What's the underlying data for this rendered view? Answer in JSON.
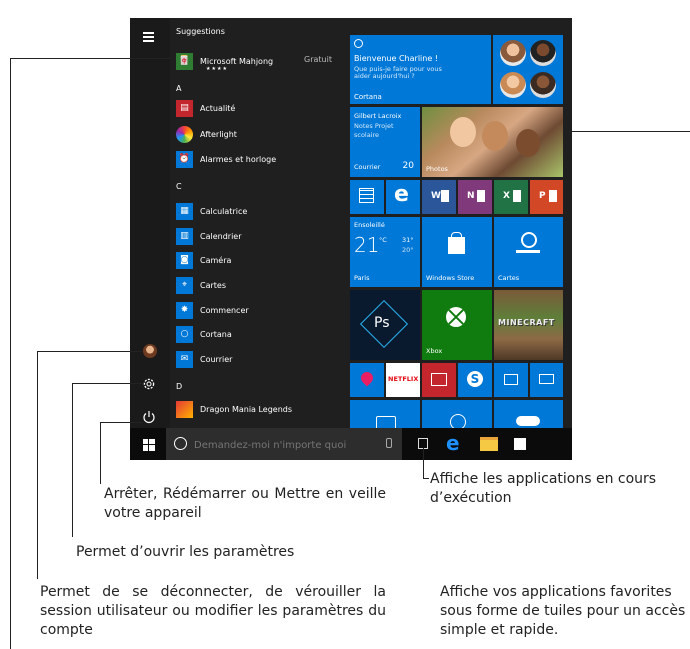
{
  "start_menu": {
    "suggestions_header": "Suggestions",
    "suggested_app": {
      "name": "Microsoft Mahjong",
      "price": "Gratuit",
      "rating": "★★★★"
    },
    "groups": [
      {
        "letter": "A",
        "apps": [
          "Actualité",
          "Afterlight",
          "Alarmes et horloge"
        ]
      },
      {
        "letter": "C",
        "apps": [
          "Calculatrice",
          "Calendrier",
          "Caméra",
          "Cartes",
          "Commencer",
          "Cortana",
          "Courrier"
        ]
      },
      {
        "letter": "D",
        "apps": [
          "Dragon Mania Legends"
        ]
      }
    ],
    "tiles": {
      "cortana": {
        "title": "Bienvenue Charline !",
        "subtitle": "Que puis-je faire pour vous aider aujourd'hui ?",
        "label": "Cortana"
      },
      "mail": {
        "sender": "Gilbert Lacroix",
        "preview": "Notes Projet scolaire",
        "label": "Courrier",
        "count": "20"
      },
      "photos": {
        "label": "Photos"
      },
      "weather": {
        "condition": "Ensoleillé",
        "temp": "21",
        "unit": "°C",
        "high": "31°",
        "low": "20°",
        "city": "Paris"
      },
      "store": {
        "label": "Windows Store"
      },
      "maps": {
        "label": "Cartes"
      },
      "xbox": {
        "label": "Xbox"
      },
      "netflix": {
        "label": "NETFLIX"
      },
      "minecraft": {
        "label": "MINECRAFT"
      },
      "word": {
        "label": "W"
      },
      "onenote": {
        "label": "N"
      },
      "excel": {
        "label": "X"
      },
      "powerpoint": {
        "label": "P"
      },
      "photoshop": {
        "label": "Ps"
      }
    },
    "taskbar": {
      "search_placeholder": "Demandez-moi n'importe quoi"
    }
  },
  "annotations": {
    "power": "Arrêter, Rédémarrer ou Mettre en veille votre appareil",
    "settings": "Permet d’ouvrir les paramètres",
    "account": "Permet de se déconnecter, de vérouiller la session utilisateur ou modifier les paramètres du compte",
    "taskview": "Affiche les applications en cours d’exécution",
    "tiles": "Affiche vos applications favorites sous forme de tuiles pour un accès simple et rapide."
  },
  "colors": {
    "accent": "#0078d7",
    "menu_bg": "#1f1f1f",
    "taskbar_bg": "#0b0b0b",
    "tile_green": "#107c10",
    "tile_red": "#e81123"
  }
}
